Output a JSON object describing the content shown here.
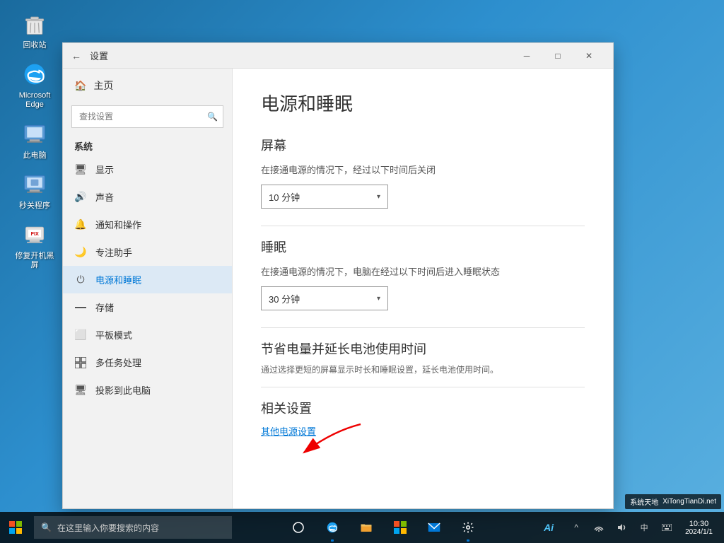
{
  "desktop": {
    "icons": [
      {
        "id": "recycle-bin",
        "label": "回收站"
      },
      {
        "id": "edge",
        "label": "Microsoft Edge"
      },
      {
        "id": "this-pc",
        "label": "此电脑"
      },
      {
        "id": "secret-app",
        "label": "秒关程序"
      },
      {
        "id": "fix-app",
        "label": "修复开机黑屏"
      }
    ]
  },
  "settings_window": {
    "title": "设置",
    "back_label": "←",
    "min_label": "─",
    "max_label": "□",
    "close_label": "✕",
    "sidebar": {
      "home_label": "主页",
      "search_placeholder": "查找设置",
      "section_label": "系统",
      "items": [
        {
          "id": "display",
          "label": "显示",
          "icon": "🖥"
        },
        {
          "id": "sound",
          "label": "声音",
          "icon": "🔊"
        },
        {
          "id": "notifications",
          "label": "通知和操作",
          "icon": "🔔"
        },
        {
          "id": "focus",
          "label": "专注助手",
          "icon": "🌙"
        },
        {
          "id": "power",
          "label": "电源和睡眠",
          "icon": "⏻",
          "active": true
        },
        {
          "id": "storage",
          "label": "存储",
          "icon": "─"
        },
        {
          "id": "tablet",
          "label": "平板模式",
          "icon": "⬜"
        },
        {
          "id": "multitask",
          "label": "多任务处理",
          "icon": "⊞"
        },
        {
          "id": "project",
          "label": "投影到此电脑",
          "icon": "🖥"
        }
      ]
    },
    "main": {
      "title": "电源和睡眠",
      "screen_section": {
        "title": "屏幕",
        "desc": "在接通电源的情况下，经过以下时间后关闭",
        "dropdown_value": "10 分钟"
      },
      "sleep_section": {
        "title": "睡眠",
        "desc": "在接通电源的情况下，电脑在经过以下时间后进入睡眠状态",
        "dropdown_value": "30 分钟"
      },
      "battery_section": {
        "title": "节省电量并延长电池使用时间",
        "desc": "通过选择更短的屏幕显示时长和睡眠设置，延长电池使用时间。"
      },
      "related_section": {
        "title": "相关设置",
        "link_label": "其他电源设置"
      }
    }
  },
  "taskbar": {
    "start_icon": "⊞",
    "search_placeholder": "在这里输入你要搜索的内容",
    "search_icon": "🔍",
    "tray_icons": [
      "^",
      "🔊",
      "中",
      "⊞"
    ],
    "ai_label": "Ai",
    "task_view_icon": "⧉",
    "edge_icon": "e",
    "file_icon": "📁",
    "store_icon": "⊞",
    "mail_icon": "✉",
    "settings_icon": "⚙"
  },
  "watermark": {
    "text": "XiTongTianDi.net"
  }
}
